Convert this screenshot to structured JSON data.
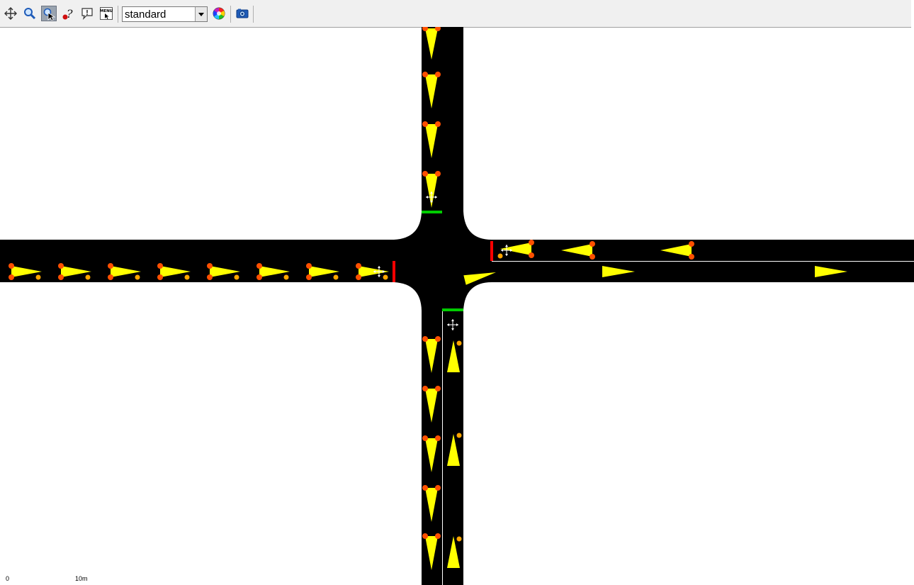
{
  "toolbar": {
    "buttons": [
      {
        "name": "pan-button",
        "icon": "pan-icon"
      },
      {
        "name": "zoom-button",
        "icon": "zoom-icon"
      },
      {
        "name": "select-button",
        "icon": "select-cursor-icon",
        "active": true
      },
      {
        "name": "help-button",
        "icon": "help-icon"
      },
      {
        "name": "info-button",
        "icon": "info-bubble-icon"
      },
      {
        "name": "menu-button",
        "icon": "menu-icon",
        "label": "MENU"
      }
    ],
    "scheme_value": "standard",
    "scheme_options": [
      "standard"
    ],
    "colors_button_icon": "color-wheel-icon",
    "screenshot_button_icon": "camera-icon"
  },
  "colors": {
    "road": "#000000",
    "vehicle": "#ffff00",
    "brake_light": "#ff5000",
    "blinker": "#ffa500",
    "signal_red": "#ff0000",
    "signal_green": "#00cc00",
    "background": "#ffffff"
  },
  "scale_bar": {
    "left_label": "0",
    "right_label": "10m"
  }
}
